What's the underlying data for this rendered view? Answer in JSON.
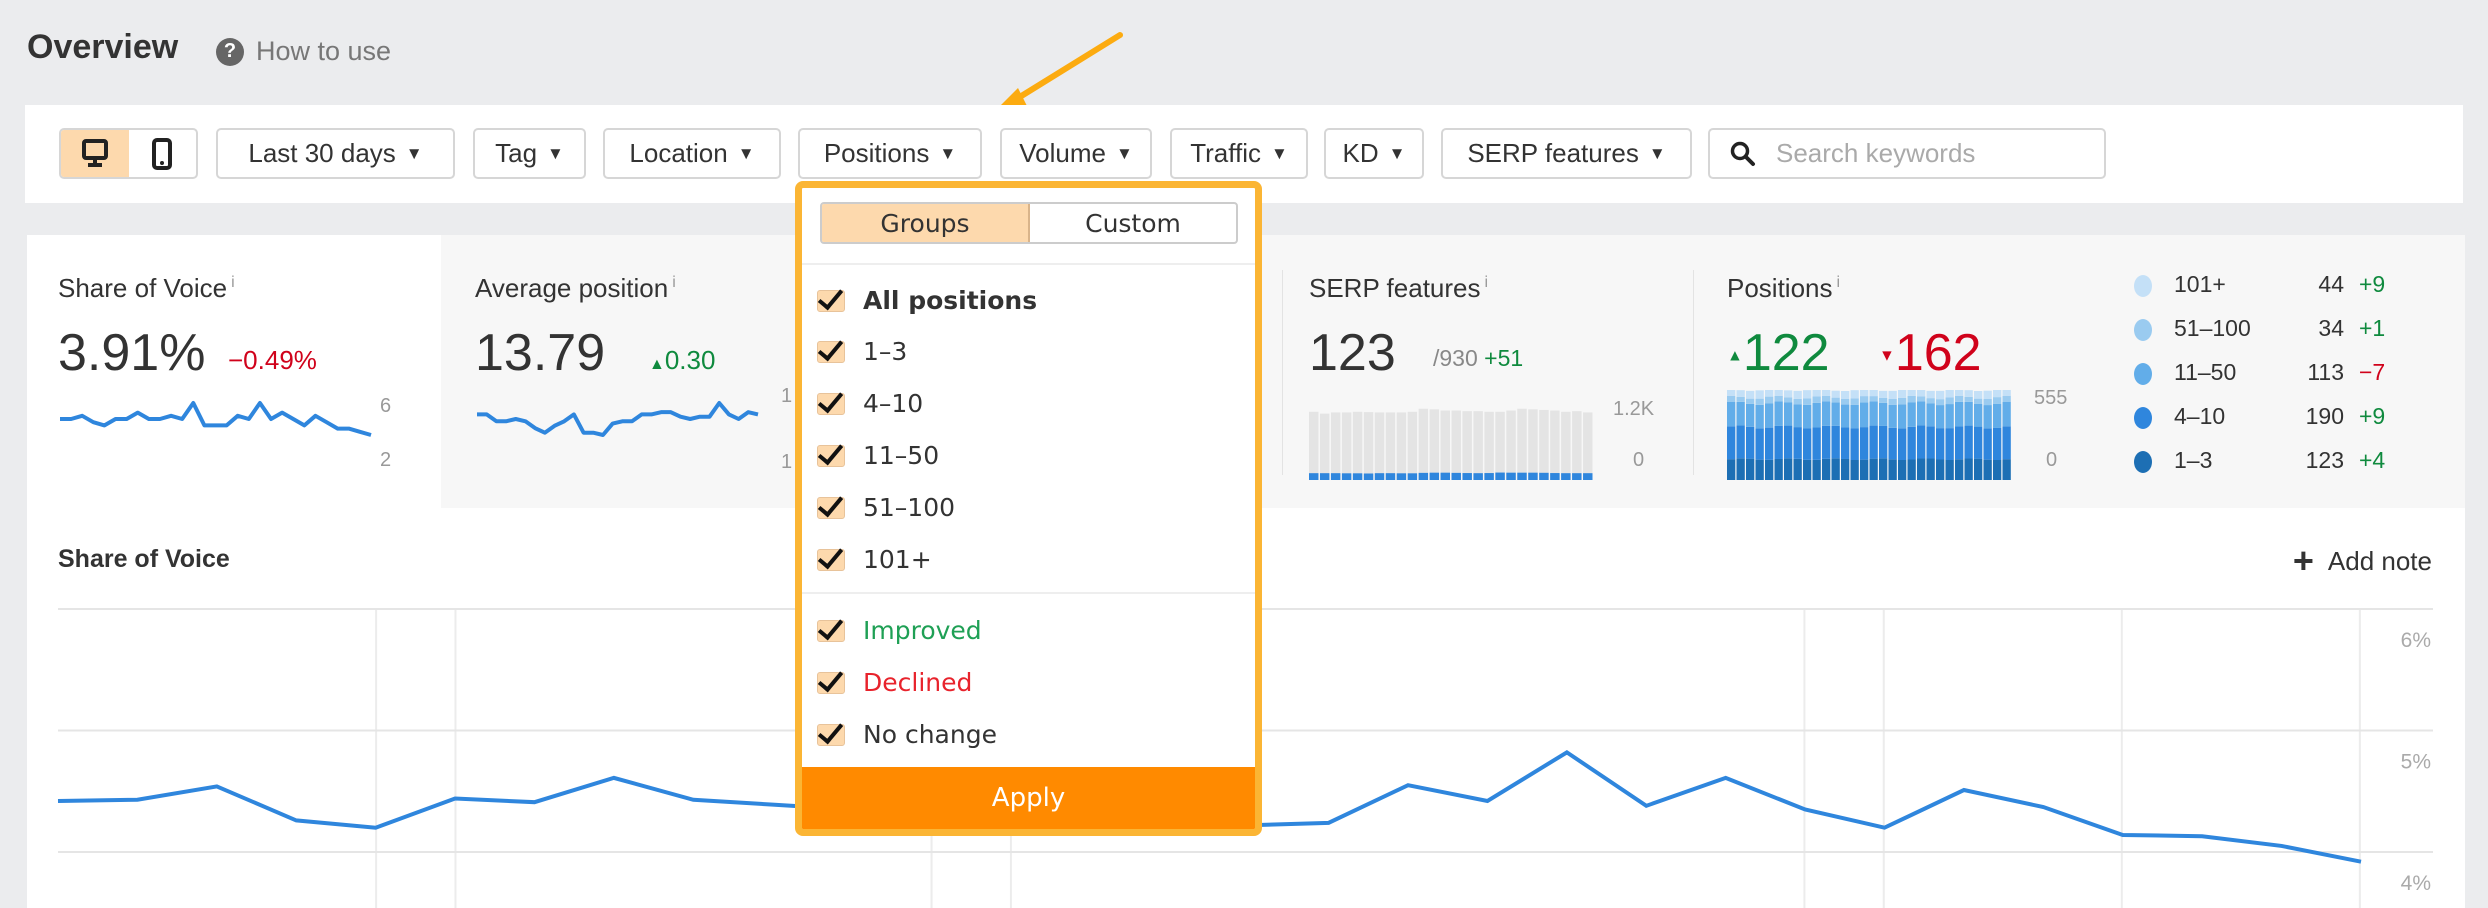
{
  "header": {
    "title": "Overview",
    "help_icon": "question-circle-icon",
    "help_label": "How to use"
  },
  "toolbar": {
    "device": {
      "desktop_icon": "desktop-icon",
      "mobile_icon": "mobile-icon",
      "selected": "desktop"
    },
    "date_range": "Last 30 days",
    "tag": "Tag",
    "location": "Location",
    "positions": "Positions",
    "volume": "Volume",
    "traffic": "Traffic",
    "kd": "KD",
    "serp_features": "SERP features",
    "search_placeholder": "Search keywords",
    "search_icon": "search-icon"
  },
  "colors": {
    "accent": "#ff8a00",
    "highlight": "#fbb534",
    "selected_bg": "#fdd9ad",
    "line": "#2f86dd",
    "positive": "#0f8a3e",
    "negative": "#d0021b",
    "annotation_arrow": "#fcab10"
  },
  "metrics": {
    "share_of_voice": {
      "title": "Share of Voice",
      "info": "i",
      "value": "3.91%",
      "delta": "−0.49%",
      "axis_max": "6",
      "axis_min": "2",
      "spark": [
        4.4,
        4.4,
        4.5,
        4.3,
        4.2,
        4.4,
        4.4,
        4.6,
        4.4,
        4.4,
        4.5,
        4.4,
        4.9,
        4.2,
        4.2,
        4.2,
        4.5,
        4.4,
        4.9,
        4.4,
        4.6,
        4.4,
        4.2,
        4.5,
        4.3,
        4.1,
        4.1,
        4.0,
        3.9
      ]
    },
    "average_position": {
      "title": "Average position",
      "info": "i",
      "value": "13.79",
      "delta": "0.30",
      "axis_max": "1",
      "axis_min": "1",
      "spark": [
        13.6,
        13.6,
        13.9,
        13.9,
        13.8,
        13.9,
        14.2,
        14.4,
        14.1,
        13.9,
        13.6,
        14.4,
        14.4,
        14.5,
        14.0,
        13.9,
        13.9,
        13.6,
        13.6,
        13.5,
        13.5,
        13.7,
        13.8,
        13.7,
        13.7,
        13.1,
        13.6,
        13.8,
        13.5,
        13.6
      ]
    },
    "serp_features": {
      "title": "SERP features",
      "info": "i",
      "value": "123",
      "total": "/930",
      "delta": "+51",
      "axis_max": "1.2K",
      "axis_min": "0",
      "totals": [
        1100,
        1070,
        1090,
        1090,
        1100,
        1095,
        1090,
        1090,
        1090,
        1100,
        1150,
        1140,
        1120,
        1120,
        1110,
        1110,
        1100,
        1100,
        1120,
        1150,
        1140,
        1130,
        1120,
        1100,
        1110,
        1090
      ],
      "found": [
        110,
        110,
        110,
        108,
        108,
        105,
        110,
        110,
        108,
        108,
        115,
        118,
        118,
        115,
        112,
        110,
        112,
        120,
        118,
        118,
        118,
        116,
        112,
        110,
        110,
        110
      ]
    },
    "positions": {
      "title": "Positions",
      "info": "i",
      "up": "122",
      "down": "162",
      "axis_max": "555",
      "axis_min": "0",
      "legend": [
        {
          "label": "101+",
          "count": "44",
          "delta": "+9",
          "color": "#c4e0f7",
          "trend": "positive"
        },
        {
          "label": "51–100",
          "count": "34",
          "delta": "+1",
          "color": "#9acbf0",
          "trend": "positive"
        },
        {
          "label": "11–50",
          "count": "113",
          "delta": "−7",
          "color": "#62ade9",
          "trend": "negative"
        },
        {
          "label": "4–10",
          "count": "190",
          "delta": "+9",
          "color": "#2f86dd",
          "trend": "positive"
        },
        {
          "label": "1–3",
          "count": "123",
          "delta": "+4",
          "color": "#1d6fb4",
          "trend": "positive"
        }
      ]
    }
  },
  "main_chart": {
    "title": "Share of Voice",
    "add_note": "Add note",
    "chart_data": {
      "type": "line",
      "ylim": [
        4,
        6.2
      ],
      "yticks": [
        "6%",
        "5%",
        "4%"
      ],
      "ytick_values": [
        6,
        5,
        4
      ],
      "values": [
        4.42,
        4.43,
        4.54,
        4.26,
        4.2,
        4.44,
        4.41,
        4.61,
        4.43,
        4.39,
        4.35,
        4.3,
        4.38,
        4.25,
        4.28,
        4.22,
        4.24,
        4.55,
        4.42,
        4.82,
        4.38,
        4.61,
        4.35,
        4.2,
        4.51,
        4.37,
        4.14,
        4.13,
        4.05,
        3.92
      ]
    }
  },
  "positions_dropdown": {
    "tabs": [
      {
        "label": "Groups",
        "selected": true
      },
      {
        "label": "Custom",
        "selected": false
      }
    ],
    "groups": [
      {
        "label": "All positions",
        "checked": true
      },
      {
        "label": "1–3",
        "checked": true
      },
      {
        "label": "4–10",
        "checked": true
      },
      {
        "label": "11–50",
        "checked": true
      },
      {
        "label": "51–100",
        "checked": true
      },
      {
        "label": "101+",
        "checked": true
      }
    ],
    "changes": [
      {
        "label": "Improved",
        "checked": true,
        "color": "#1fa055"
      },
      {
        "label": "Declined",
        "checked": true,
        "color": "#e8232c"
      },
      {
        "label": "No change",
        "checked": true,
        "color": "#333333"
      }
    ],
    "apply": "Apply"
  }
}
